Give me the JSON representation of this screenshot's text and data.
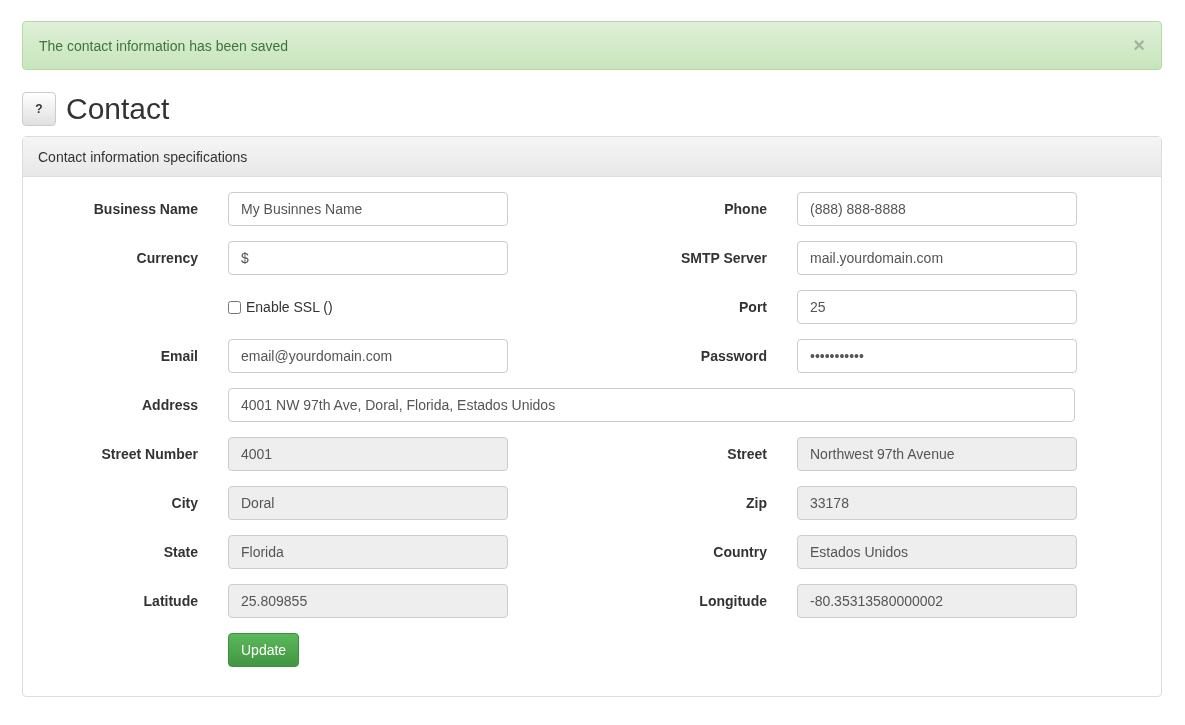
{
  "alert": {
    "message": "The contact information has been saved",
    "close": "×"
  },
  "header": {
    "help": "?",
    "title": "Contact"
  },
  "panel": {
    "heading": "Contact information specifications",
    "rows": [
      {
        "kind": "pair",
        "left": {
          "label": "Business Name",
          "value": "My Businnes Name",
          "readonly": false
        },
        "right": {
          "label": "Phone",
          "value": "(888) 888-8888",
          "readonly": false
        }
      },
      {
        "kind": "pair",
        "left": {
          "label": "Currency",
          "value": "$",
          "readonly": false
        },
        "right": {
          "label": "SMTP Server",
          "value": "mail.yourdomain.com",
          "readonly": false
        }
      },
      {
        "kind": "checkbox",
        "check": {
          "label": "Enable SSL ()",
          "checked": false
        },
        "right": {
          "label": "Port",
          "value": "25",
          "readonly": false
        }
      },
      {
        "kind": "pair",
        "left": {
          "label": "Email",
          "value": "email@yourdomain.com",
          "readonly": false
        },
        "right": {
          "label": "Password",
          "value": "•••••••••••",
          "readonly": false
        }
      },
      {
        "kind": "wide",
        "left": {
          "label": "Address",
          "value": "4001 NW 97th Ave, Doral, Florida, Estados Unidos",
          "readonly": false
        }
      },
      {
        "kind": "pair",
        "left": {
          "label": "Street Number",
          "value": "4001",
          "readonly": true
        },
        "right": {
          "label": "Street",
          "value": "Northwest 97th Avenue",
          "readonly": true
        }
      },
      {
        "kind": "pair",
        "left": {
          "label": "City",
          "value": "Doral",
          "readonly": true
        },
        "right": {
          "label": "Zip",
          "value": "33178",
          "readonly": true
        }
      },
      {
        "kind": "pair",
        "left": {
          "label": "State",
          "value": "Florida",
          "readonly": true
        },
        "right": {
          "label": "Country",
          "value": "Estados Unidos",
          "readonly": true
        }
      },
      {
        "kind": "pair",
        "left": {
          "label": "Latitude",
          "value": "25.809855",
          "readonly": true
        },
        "right": {
          "label": "Longitude",
          "value": "-80.35313580000002",
          "readonly": true
        }
      }
    ],
    "submit": "Update"
  }
}
